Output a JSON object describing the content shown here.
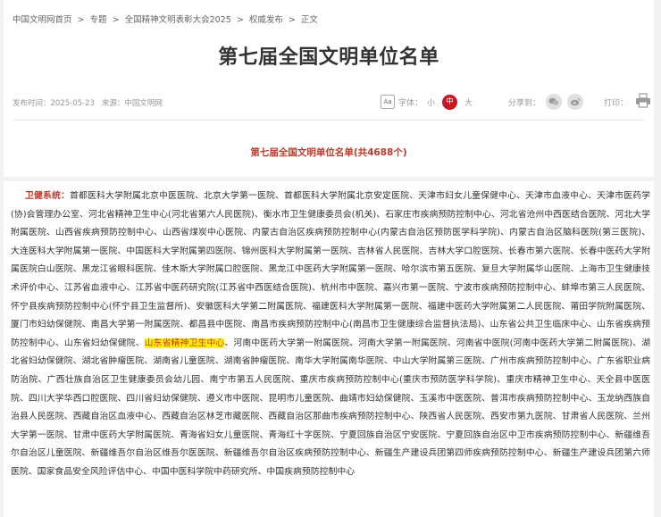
{
  "breadcrumb": [
    "中国文明网首页",
    "专题",
    "全国精神文明表彰大会2025",
    "权威发布",
    "正文"
  ],
  "breadcrumb_sep": ">",
  "article": {
    "title": "第七届全国文明单位名单",
    "publish_time": "发布时间：2025-05-23",
    "source": "来源：中国文明网",
    "subtitle": "第七届全国文明单位名单(共4688个)"
  },
  "font_size": {
    "label": "字体：",
    "options": [
      "小",
      "中",
      "大"
    ],
    "selected": "中"
  },
  "share": {
    "label": "分享到：",
    "icons": [
      "wechat-icon",
      "weibo-icon"
    ]
  },
  "print": {
    "label": "打印：",
    "icon": "printer-icon"
  },
  "content": {
    "category_label": "卫健系统：",
    "text_before": "首都医科大学附属北京中医医院、北京大学第一医院、首都医科大学附属北京安定医院、天津市妇女儿童保健中心、天津市血液中心、天津市医药学(协)会管理办公室、河北省精神卫生中心(河北省第六人民医院)、衡水市卫生健康委员会(机关)、石家庄市疾病预防控制中心、河北省沧州中西医结合医院、河北大学附属医院、山西省疾病预防控制中心、山西省煤炭中心医院、内蒙古自治区疾病预防控制中心(内蒙古自治区预防医学科学院)、内蒙古自治区脑科医院(第三医院)、大连医科大学附属第一医院、中国医科大学附属第四医院、锦州医科大学附属第一医院、吉林省人民医院、吉林大学口腔医院、长春市第六医院、长春中医药大学附属医院白山医院、黑龙江省眼科医院、佳木斯大学附属口腔医院、黑龙江中医药大学附属第一医院、哈尔滨市第五医院、复旦大学附属华山医院、上海市卫生健康技术评价中心、江苏省血液中心、江苏省中医药研究院(江苏省中西医结合医院)、杭州市中医院、嘉兴市第一医院、宁波市疾病预防控制中心、蚌埠市第三人民医院、怀宁县疾病预防控制中心(怀宁县卫生监督所)、安徽医科大学第二附属医院、福建医科大学附属第一医院、福建中医药大学附属第二人民医院、莆田学院附属医院、厦门市妇幼保健院、南昌大学第一附属医院、都昌县中医院、南昌市疾病预防控制中心(南昌市卫生健康综合监督执法局)、山东省公共卫生临床中心、山东省疾病预防控制中心、山东省妇幼保健院、",
    "highlight": "山东省精神卫生中心",
    "text_after": "、河南中医药大学第一附属医院、河南大学第一附属医院、河南省中医院(河南中医药大学第二附属医院)、湖北省妇幼保健院、湖北省肿瘤医院、湖南省儿童医院、湖南省肿瘤医院、南华大学附属南华医院、中山大学附属第三医院、广州市疾病预防控制中心、广东省职业病防治院、广西壮族自治区卫生健康委员会幼儿园、南宁市第五人民医院、重庆市疾病预防控制中心(重庆市预防医学科学院)、重庆市精神卫生中心、天全县中医医院、四川大学华西口腔医院、四川省妇幼保健院、遵义市中医院、昆明市儿童医院、曲靖市妇幼保健院、玉溪市中医医院、普洱市疾病预防控制中心、玉龙纳西族自治县人民医院、西藏自治区血液中心、西藏自治区林芝市藏医院、西藏自治区那曲市疾病预防控制中心、陕西省人民医院、西安市第九医院、甘肃省人民医院、兰州大学第一医院、甘肃中医药大学附属医院、青海省妇女儿童医院、青海红十字医院、宁夏回族自治区宁安医院、宁夏回族自治区中卫市疾病预防控制中心、新疆维吾尔自治区儿童医院、新疆维吾尔自治区维吾尔医医院、新疆维吾尔自治区疾病预防控制中心、新疆生产建设兵团第四师疾病预防控制中心、新疆生产建设兵团第六师医院、国家食品安全风险评估中心、中国中医科学院中药研究所、中国疾病预防控制中心"
  },
  "colors": {
    "accent_red": "#c81623",
    "category_red": "#c0392b",
    "highlight_yellow": "#fff200",
    "page_bg": "#f2f2f2"
  }
}
